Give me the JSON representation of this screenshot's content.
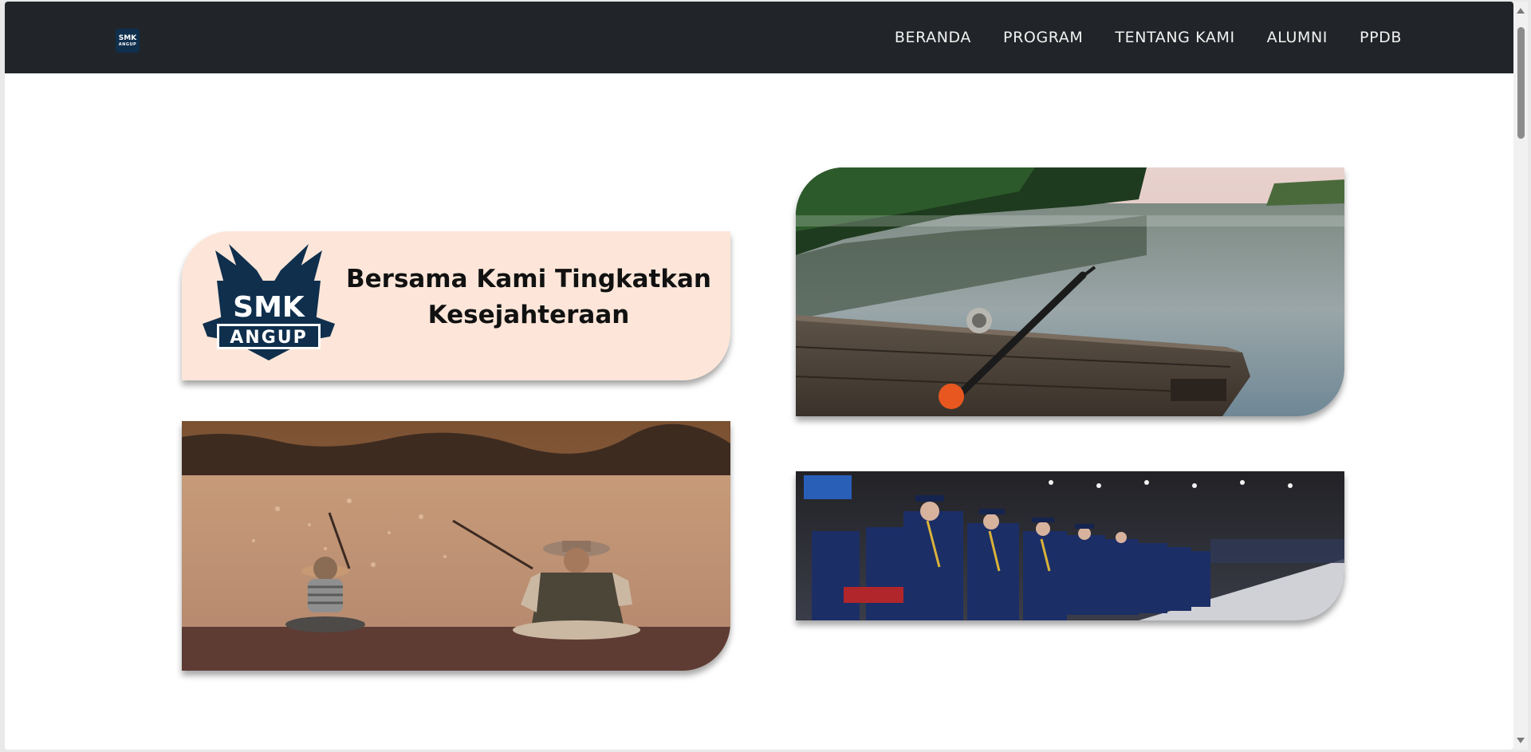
{
  "nav": {
    "logo_line1": "SMK",
    "logo_line2": "ANGUP",
    "items": [
      {
        "label": "BERANDA"
      },
      {
        "label": "PROGRAM"
      },
      {
        "label": "TENTANG KAMI"
      },
      {
        "label": "ALUMNI"
      },
      {
        "label": "PPDB"
      }
    ]
  },
  "hero": {
    "banner": {
      "logo_line1": "SMK",
      "logo_line2": "ANGUP",
      "line1": "Bersama Kami Tingkatkan",
      "line2": "Kesejahteraan"
    }
  },
  "colors": {
    "navbar": "#212529",
    "banner_bg": "#fde6d9",
    "logo_navy": "#0f2f4d"
  },
  "icons": {
    "scroll_up": "triangle-up",
    "scroll_down": "triangle-down"
  }
}
